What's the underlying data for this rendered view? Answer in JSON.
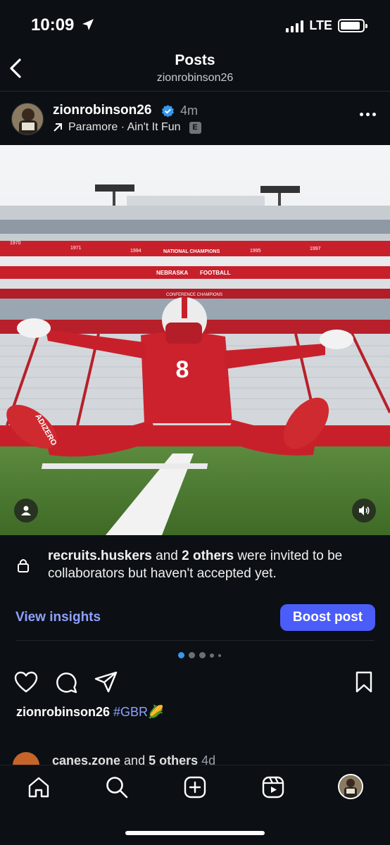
{
  "status": {
    "time": "10:09",
    "network": "LTE",
    "battery_level": 0.9
  },
  "header": {
    "title": "Posts",
    "subtitle": "zionrobinson26"
  },
  "post": {
    "username": "zionrobinson26",
    "time_ago": "4m",
    "music": {
      "artist_song": "Paramore · Ain't It Fun",
      "explicit_badge": "E"
    },
    "photo": {
      "banners": [
        "1970",
        "1971",
        "1994",
        "NATIONAL CHAMPIONS",
        "1995",
        "1997",
        "NEBRASKA",
        "FOOTBALL",
        "CONFERENCE CHAMPIONS"
      ],
      "jersey_number": "8",
      "cleat_text": "ADIZERO"
    },
    "collab": {
      "user": "recruits.huskers",
      "connector": " and ",
      "others": "2 others",
      "rest": " were invited to be collaborators but haven't accepted yet."
    },
    "view_insights": "View insights",
    "boost_post": "Boost post",
    "carousel": {
      "count": 5,
      "active_index": 0
    },
    "caption": {
      "user": "zionrobinson26",
      "hashtag": "#GBR",
      "emoji": "🌽"
    }
  },
  "next_post": {
    "user": "canes.zone",
    "connector": " and ",
    "others": "5 others",
    "time_ago": "4d"
  },
  "colors": {
    "background": "#0c1014",
    "accent": "#4a5df9",
    "link": "#8ea1ff"
  }
}
